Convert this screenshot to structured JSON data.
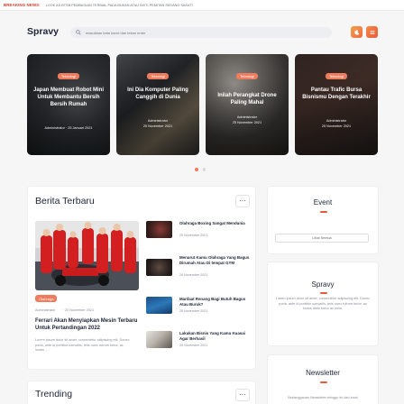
{
  "breaking": {
    "label": "BREAKING NEWS:",
    "text": "LOOK AS BTSB PEMBAGIAN TERBIAL PADA BUKAN ATAU INVTI PEMITAN SEDANG SAKATI"
  },
  "header": {
    "logo": "Spravy",
    "search_placeholder": "masukkan kata kunci dan tekan enter"
  },
  "slider": {
    "cards": [
      {
        "tag": "Teknologi",
        "title": "Japan Membuat Robot Mini Untuk Membantu Bersih Bersih Rumah",
        "author": "Administrator",
        "date": "25 Januari 2021",
        "meta_inline": "Administrator · 25 Januari 2021"
      },
      {
        "tag": "Teknologi",
        "title": "Ini Dia Komputer Paling Canggih di Dunia",
        "author": "Administrator",
        "date": "25 November 2021"
      },
      {
        "tag": "Teknologi",
        "title": "Inilah Perangkat Drone Paling Mahal",
        "author": "Administrator",
        "date": "25 November 2021"
      },
      {
        "tag": "Teknologi",
        "title": "Pantau Trafic Bursa Bisnismu Dengan Terakhir",
        "author": "Administrator",
        "date": "25 November 2021"
      }
    ]
  },
  "main": {
    "title": "Berita Terbaru",
    "more": "···",
    "featured": {
      "tag": "Olahraga",
      "author": "Administrator",
      "date": "20 November 2021",
      "title": "Ferrari Akan Menyiapkan Mesin Terbaru Untuk Pertandingan 2022",
      "excerpt": "Lorem ipsum dolor sit amet, consectetur adipiscing elit. Donec porta, ante id porttitor convallis, felis nunc rutrum tortor, ac luctus ..."
    },
    "items": [
      {
        "title": "Olahraga Boxing Sangat Mendunia",
        "date": "20 November 2021"
      },
      {
        "title": "Menurut Kamu Olahraga Yang Bagus Dirumah Atau Di tempat GYM",
        "date": "20 November 2021"
      },
      {
        "title": "Manfaat Renang Bagi Butuh Bagus Atau Buruk?",
        "date": "20 November 2021"
      },
      {
        "title": "Lakukan Bisnis Yang Kamu Kuasai Agar Berhasil",
        "date": "25 November 2021"
      }
    ]
  },
  "widgets": {
    "event": {
      "title": "Event",
      "button": "Lihat Semua"
    },
    "about": {
      "title": "Spravy",
      "text": "Lorem ipsum dolor sit amet, consectetur adipiscing elit. Donec porta, ante id porttitor convallis, felis nunc rutrum tortor, ac luctus diam tortor ac enim."
    },
    "newsletter": {
      "title": "Newsletter",
      "text": "Berlangganan Newsletter minggu ini dari kami"
    }
  },
  "trending": {
    "title": "Trending",
    "more": "···"
  },
  "colors": {
    "accent": "#f07c5e",
    "accent_dark": "#e55b3c",
    "text": "#1d2338",
    "muted": "#8a8d99"
  }
}
